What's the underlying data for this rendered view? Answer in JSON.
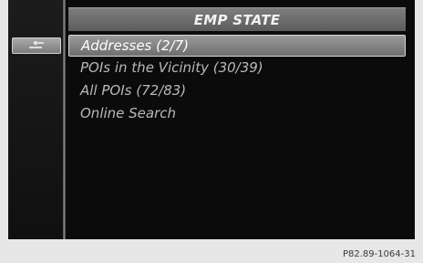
{
  "header": {
    "title": "EMP STATE"
  },
  "left_panel": {
    "back_icon": "back-arrow-icon"
  },
  "list": {
    "items": [
      {
        "label": "Addresses  (2/7)",
        "selected": true
      },
      {
        "label": "POIs in the Vicinity  (30/39)",
        "selected": false
      },
      {
        "label": "All POIs  (72/83)",
        "selected": false
      },
      {
        "label": "Online Search",
        "selected": false
      }
    ]
  },
  "footer": {
    "reference_code": "P82.89-1064-31"
  },
  "colors": {
    "screen_background": "#0b0b0b",
    "highlight": "#9a9a9a",
    "text": "#b9b9b9",
    "selected_text": "#ffffff"
  }
}
